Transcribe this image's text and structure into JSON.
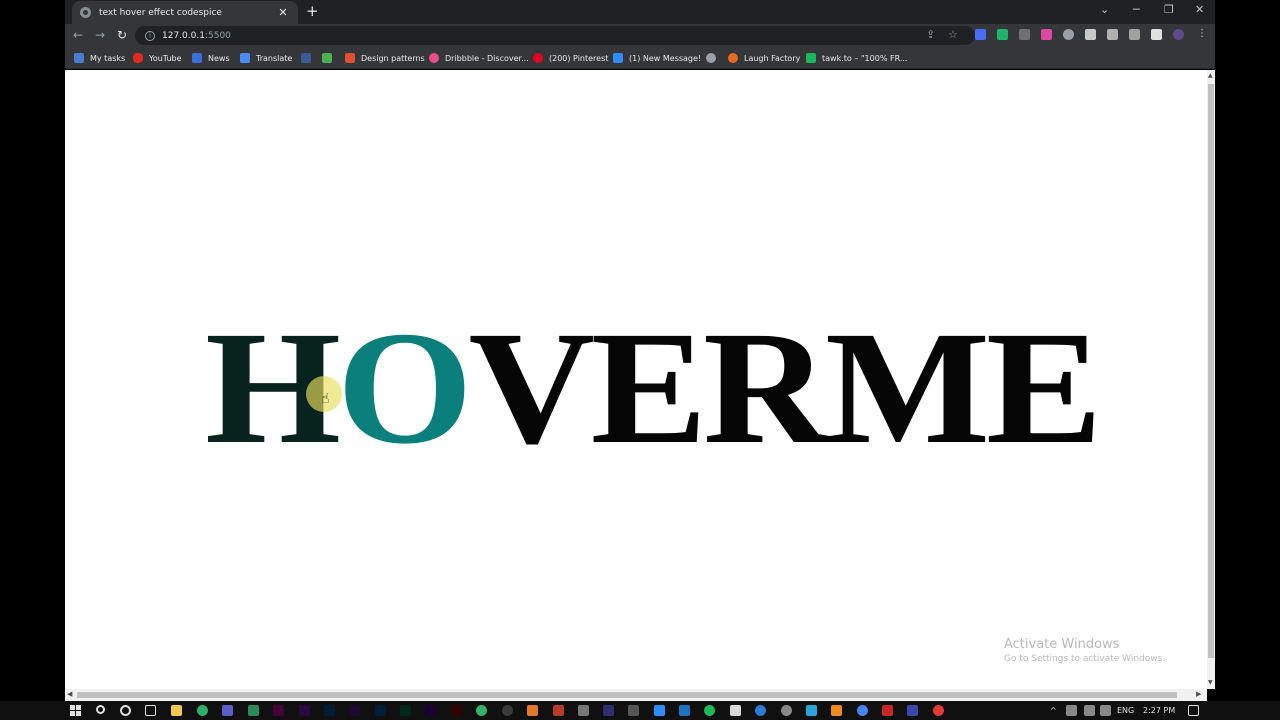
{
  "browser": {
    "tab_title": "text hover effect codespice",
    "tab_close": "✕",
    "new_tab": "+",
    "url_host": "127.0.0.1",
    "url_port": ":5500",
    "bookmarks": [
      {
        "label": "My tasks",
        "color": "#4a7bd0"
      },
      {
        "label": "YouTube",
        "color": "#e02a20"
      },
      {
        "label": "News",
        "color": "#3b6fd8"
      },
      {
        "label": "Translate",
        "color": "#4c8bf5"
      },
      {
        "label": "",
        "color": "#3b5998"
      },
      {
        "label": "",
        "color": "#4caf50"
      },
      {
        "label": "Design patterns",
        "color": "#e05030"
      },
      {
        "label": "Dribbble - Discover...",
        "color": "#ea4c89"
      },
      {
        "label": "(200) Pinterest",
        "color": "#e60023"
      },
      {
        "label": "(1) New Message!",
        "color": "#2d8cff"
      },
      {
        "label": "",
        "color": "#9aa0a6"
      },
      {
        "label": "Laugh Factory",
        "color": "#e86a1c"
      },
      {
        "label": "tawk.to – \"100% FR...",
        "color": "#18b95c"
      }
    ]
  },
  "page": {
    "letters": [
      "H",
      "O",
      "V",
      "E",
      "R",
      "M",
      "E"
    ],
    "accent_color": "#0a7f7c"
  },
  "watermark": {
    "line1": "Activate Windows",
    "line2": "Go to Settings to activate Windows."
  },
  "taskbar": {
    "language": "ENG",
    "time": "2:27 PM"
  }
}
